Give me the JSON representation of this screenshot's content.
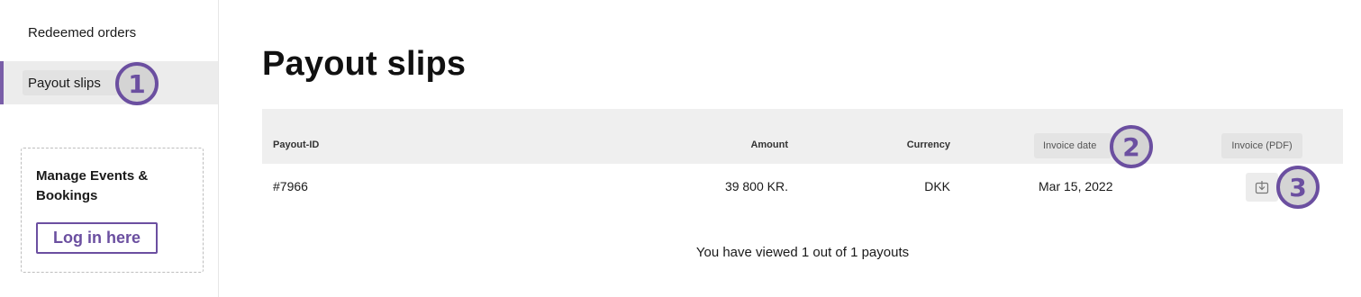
{
  "sidebar": {
    "items": [
      {
        "label": "Redeemed orders"
      },
      {
        "label": "Payout slips",
        "active": true
      }
    ],
    "manage_box": {
      "title": "Manage Events & Bookings",
      "login_label": "Log in here"
    }
  },
  "annotations": [
    "1",
    "2",
    "3"
  ],
  "main": {
    "title": "Payout slips",
    "table": {
      "columns": [
        "Payout-ID",
        "Amount",
        "Currency",
        "Invoice date",
        "Invoice (PDF)"
      ],
      "rows": [
        {
          "payout_id": "#7966",
          "amount": "39 800 KR.",
          "currency": "DKK",
          "invoice_date": "Mar 15, 2022",
          "pdf_icon": "download-icon"
        }
      ]
    },
    "footer": "You have viewed 1 out of 1 payouts"
  },
  "colors": {
    "accent": "#6b4fa0",
    "badge_bg": "#d4d4d4",
    "header_bg": "#efefef",
    "active_nav_bg": "#ececec"
  }
}
